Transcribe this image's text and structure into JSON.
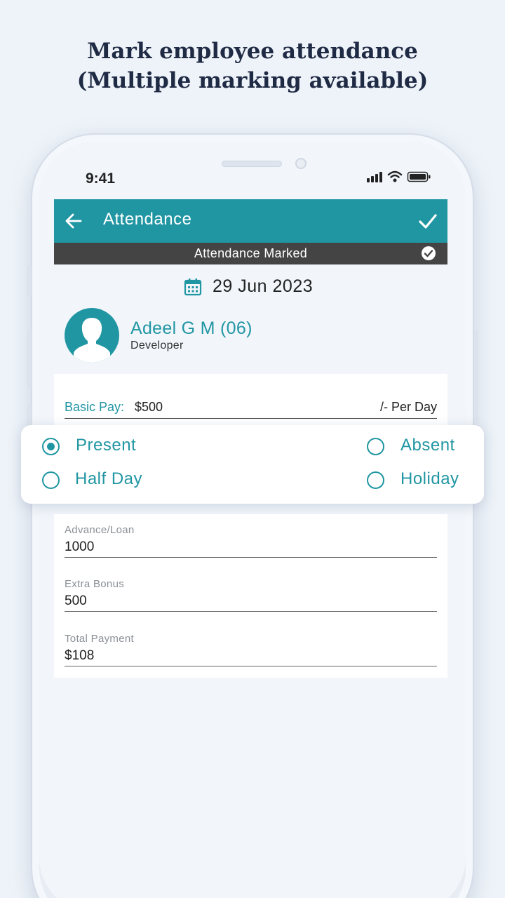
{
  "promo": {
    "line1": "Mark employee attendance",
    "line2": "(Multiple marking available)"
  },
  "status_bar": {
    "time": "9:41",
    "icons": [
      "signal-icon",
      "wifi-icon",
      "battery-icon"
    ]
  },
  "appbar": {
    "title": "Attendance",
    "back_icon": "arrow-left-icon",
    "confirm_icon": "check-icon",
    "color": "#2196a3"
  },
  "banner": {
    "text": "Attendance Marked",
    "icon": "check-circle-icon",
    "color": "#444444"
  },
  "date": {
    "icon": "calendar-icon",
    "value": "29 Jun 2023"
  },
  "employee": {
    "name": "Adeel G M (06)",
    "role": "Developer",
    "avatar_icon": "person-silhouette-icon"
  },
  "pay": {
    "label": "Basic Pay:",
    "value": "$500",
    "unit": "/- Per Day"
  },
  "attendance_options": [
    {
      "label": "Present",
      "selected": true
    },
    {
      "label": "Absent",
      "selected": false
    },
    {
      "label": "Half Day",
      "selected": false
    },
    {
      "label": "Holiday",
      "selected": false
    }
  ],
  "fields": [
    {
      "label": "Advance/Loan",
      "value": "1000"
    },
    {
      "label": "Extra Bonus",
      "value": "500"
    },
    {
      "label": "Total Payment",
      "value": "$108"
    }
  ]
}
